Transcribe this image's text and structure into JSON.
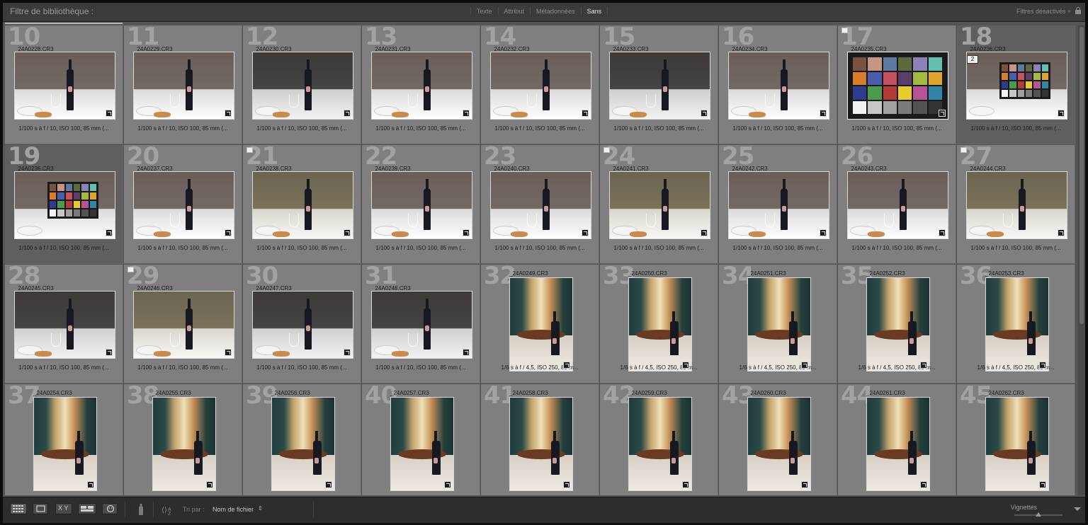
{
  "filter_bar": {
    "title": "Filtre de bibliothèque :",
    "tabs": [
      {
        "label": "Texte",
        "active": false
      },
      {
        "label": "Attribut",
        "active": false
      },
      {
        "label": "Métadonnées",
        "active": false
      },
      {
        "label": "Sans",
        "active": true
      }
    ],
    "filters_status": "Filtres désactivés ÷"
  },
  "grid": {
    "cells": [
      {
        "index": "10",
        "filename": "_24A0228.CR3",
        "meta": "1/100 s à f / 10, ISO 100, 85 mm (...",
        "orientation": "landscape",
        "tone": "normal",
        "flag": false,
        "selected": false
      },
      {
        "index": "11",
        "filename": "_24A0229.CR3",
        "meta": "1/100 s à f / 10, ISO 100, 85 mm (...",
        "orientation": "landscape",
        "tone": "normal",
        "flag": false,
        "selected": false
      },
      {
        "index": "12",
        "filename": "_24A0230.CR3",
        "meta": "1/100 s à f / 10, ISO 100, 85 mm (...",
        "orientation": "landscape",
        "tone": "dark",
        "flag": false,
        "selected": false
      },
      {
        "index": "13",
        "filename": "_24A0231.CR3",
        "meta": "1/100 s à f / 10, ISO 100, 85 mm (...",
        "orientation": "landscape",
        "tone": "normal",
        "flag": false,
        "selected": false
      },
      {
        "index": "14",
        "filename": "_24A0232.CR3",
        "meta": "1/100 s à f / 10, ISO 100, 85 mm (...",
        "orientation": "landscape",
        "tone": "normal",
        "flag": false,
        "selected": false
      },
      {
        "index": "15",
        "filename": "_24A0233.CR3",
        "meta": "1/100 s à f / 10, ISO 100, 85 mm (...",
        "orientation": "landscape",
        "tone": "dark",
        "flag": false,
        "selected": false
      },
      {
        "index": "16",
        "filename": "_24A0234.CR3",
        "meta": "1/100 s à f / 10, ISO 100, 85 mm (...",
        "orientation": "landscape",
        "tone": "normal",
        "flag": false,
        "selected": false
      },
      {
        "index": "17",
        "filename": "_24A0235.CR3",
        "meta": "1/100 s à f / 10, ISO 100, 85 mm (...",
        "orientation": "landscape",
        "tone": "checker",
        "flag": true,
        "selected": false
      },
      {
        "index": "18",
        "filename": "_24A0236.CR3",
        "meta": "1/100 s à f / 10, ISO 100, 85 mm (...",
        "orientation": "landscape",
        "tone": "checker-hand",
        "flag": false,
        "selected": true,
        "stack": "2"
      },
      {
        "index": "19",
        "filename": "_24A0236.CR3",
        "meta": "1/100 s à f / 10, ISO 100, 85 mm (...",
        "orientation": "landscape",
        "tone": "checker-hand",
        "flag": false,
        "selected": true
      },
      {
        "index": "20",
        "filename": "_24A0237.CR3",
        "meta": "1/100 s à f / 10, ISO 100, 85 mm (...",
        "orientation": "landscape",
        "tone": "normal",
        "flag": false,
        "selected": false
      },
      {
        "index": "21",
        "filename": "_24A0238.CR3",
        "meta": "1/100 s à f / 10, ISO 100, 85 mm (...",
        "orientation": "landscape",
        "tone": "olive",
        "flag": true,
        "selected": false
      },
      {
        "index": "22",
        "filename": "_24A0239.CR3",
        "meta": "1/100 s à f / 10, ISO 100, 85 mm (...",
        "orientation": "landscape",
        "tone": "normal",
        "flag": false,
        "selected": false
      },
      {
        "index": "23",
        "filename": "_24A0240.CR3",
        "meta": "1/100 s à f / 10, ISO 100, 85 mm (...",
        "orientation": "landscape",
        "tone": "normal",
        "flag": false,
        "selected": false
      },
      {
        "index": "24",
        "filename": "_24A0241.CR3",
        "meta": "1/100 s à f / 10, ISO 100, 85 mm (...",
        "orientation": "landscape",
        "tone": "olive",
        "flag": true,
        "selected": false
      },
      {
        "index": "25",
        "filename": "_24A0242.CR3",
        "meta": "1/100 s à f / 10, ISO 100, 85 mm (...",
        "orientation": "landscape",
        "tone": "normal",
        "flag": false,
        "selected": false
      },
      {
        "index": "26",
        "filename": "_24A0243.CR3",
        "meta": "1/100 s à f / 10, ISO 100, 85 mm (...",
        "orientation": "landscape",
        "tone": "normal",
        "flag": false,
        "selected": false
      },
      {
        "index": "27",
        "filename": "_24A0244.CR3",
        "meta": "1/100 s à f / 10, ISO 100, 85 mm (...",
        "orientation": "landscape",
        "tone": "olive",
        "flag": true,
        "selected": false
      },
      {
        "index": "28",
        "filename": "_24A0245.CR3",
        "meta": "1/100 s à f / 10, ISO 100, 85 mm (...",
        "orientation": "landscape",
        "tone": "dark",
        "flag": false,
        "selected": false
      },
      {
        "index": "29",
        "filename": "_24A0246.CR3",
        "meta": "1/100 s à f / 10, ISO 100, 85 mm (...",
        "orientation": "landscape",
        "tone": "olive",
        "flag": true,
        "selected": false
      },
      {
        "index": "30",
        "filename": "_24A0247.CR3",
        "meta": "1/100 s à f / 10, ISO 100, 85 mm (...",
        "orientation": "landscape",
        "tone": "dark",
        "flag": false,
        "selected": false
      },
      {
        "index": "31",
        "filename": "_24A0248.CR3",
        "meta": "1/100 s à f / 10, ISO 100, 85 mm (...",
        "orientation": "landscape",
        "tone": "dark",
        "flag": false,
        "selected": false
      },
      {
        "index": "32",
        "filename": "_24A0249.CR3",
        "meta": "1/6 s à f / 4,5, ISO 250, 85 m...",
        "orientation": "portrait",
        "tone": "portrait",
        "flag": false,
        "selected": false
      },
      {
        "index": "33",
        "filename": "_24A0250.CR3",
        "meta": "1/6 s à f / 4,5, ISO 250, 85 m...",
        "orientation": "portrait",
        "tone": "portrait",
        "flag": false,
        "selected": false
      },
      {
        "index": "34",
        "filename": "_24A0251.CR3",
        "meta": "1/6 s à f / 4,5, ISO 250, 85 m...",
        "orientation": "portrait",
        "tone": "portrait",
        "flag": false,
        "selected": false
      },
      {
        "index": "35",
        "filename": "_24A0252.CR3",
        "meta": "1/6 s à f / 4,5, ISO 250, 85 m...",
        "orientation": "portrait",
        "tone": "portrait",
        "flag": false,
        "selected": false
      },
      {
        "index": "36",
        "filename": "_24A0253.CR3",
        "meta": "1/6 s à f / 4,5, ISO 250, 85 m...",
        "orientation": "portrait",
        "tone": "portrait",
        "flag": false,
        "selected": false
      },
      {
        "index": "37",
        "filename": "_24A0254.CR3",
        "meta": "",
        "orientation": "portrait",
        "tone": "portrait",
        "flag": false,
        "selected": false
      },
      {
        "index": "38",
        "filename": "_24A0255.CR3",
        "meta": "",
        "orientation": "portrait",
        "tone": "portrait",
        "flag": false,
        "selected": false
      },
      {
        "index": "39",
        "filename": "_24A0256.CR3",
        "meta": "",
        "orientation": "portrait",
        "tone": "portrait",
        "flag": false,
        "selected": false
      },
      {
        "index": "40",
        "filename": "_24A0257.CR3",
        "meta": "",
        "orientation": "portrait",
        "tone": "portrait",
        "flag": false,
        "selected": false
      },
      {
        "index": "41",
        "filename": "_24A0258.CR3",
        "meta": "",
        "orientation": "portrait",
        "tone": "portrait",
        "flag": false,
        "selected": false
      },
      {
        "index": "42",
        "filename": "_24A0259.CR3",
        "meta": "",
        "orientation": "portrait",
        "tone": "portrait",
        "flag": false,
        "selected": false
      },
      {
        "index": "43",
        "filename": "_24A0260.CR3",
        "meta": "",
        "orientation": "portrait",
        "tone": "portrait",
        "flag": false,
        "selected": false
      },
      {
        "index": "44",
        "filename": "_24A0261.CR3",
        "meta": "",
        "orientation": "portrait",
        "tone": "portrait",
        "flag": false,
        "selected": false
      },
      {
        "index": "45",
        "filename": "_24A0262.CR3",
        "meta": "",
        "orientation": "portrait",
        "tone": "portrait",
        "flag": false,
        "selected": false
      }
    ],
    "checker_colors": [
      "#7a5240",
      "#c79583",
      "#5f7aa1",
      "#5a6b3e",
      "#8e81b8",
      "#63c0ae",
      "#d97c2c",
      "#4a5cad",
      "#c5525e",
      "#5c3c6b",
      "#a2bb3f",
      "#e0a32e",
      "#2d3c8e",
      "#4c9a4b",
      "#b33a35",
      "#e8cb2f",
      "#b65495",
      "#2f86a8",
      "#f3f3f3",
      "#c8c8c8",
      "#a0a0a0",
      "#7a7a7a",
      "#535353",
      "#333333"
    ]
  },
  "toolbar": {
    "sort_label": "Tri par :",
    "sort_value": "Nom de fichier",
    "compare_label": "X Y",
    "thumbnail_label": "Vignettes"
  }
}
